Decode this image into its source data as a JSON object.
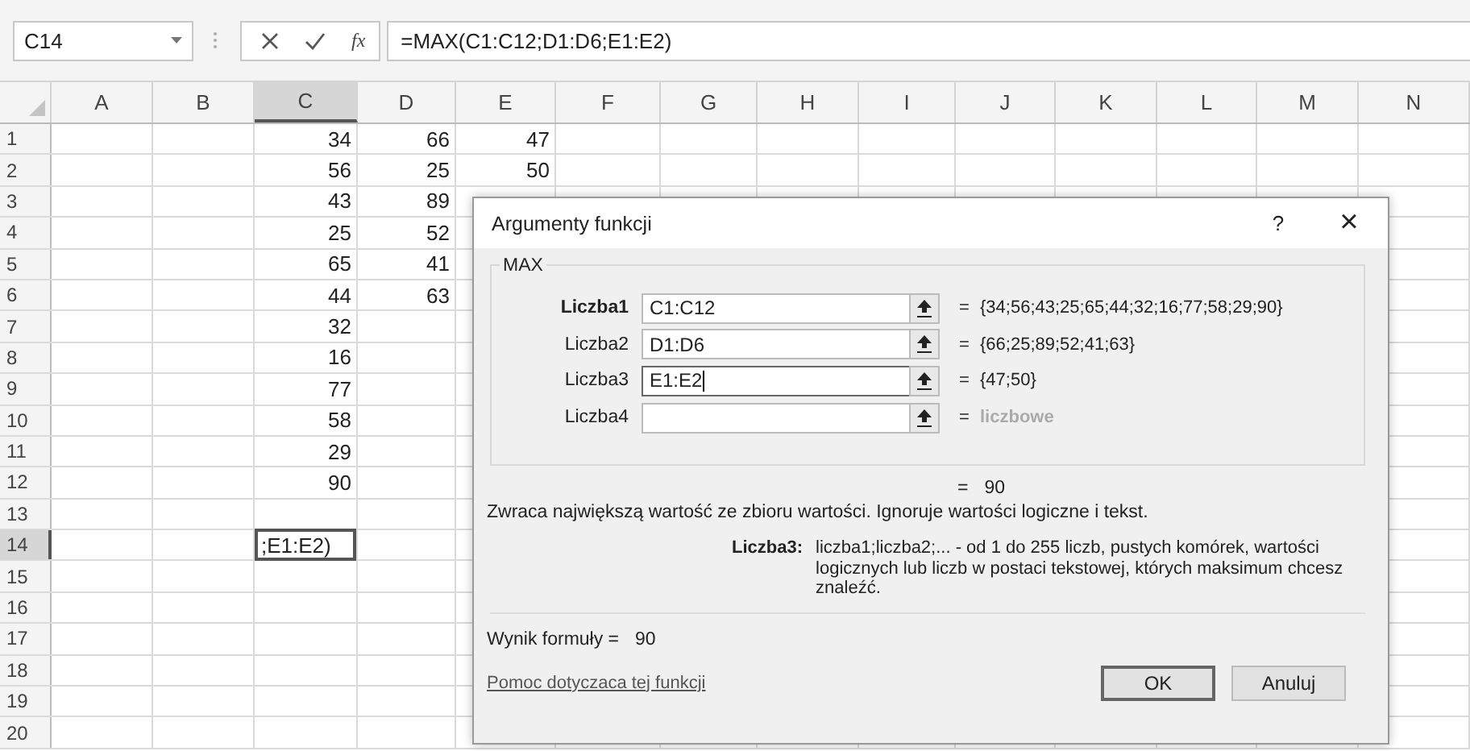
{
  "name_box": {
    "value": "C14"
  },
  "formula_bar": {
    "fx_label": "fx",
    "value": "=MAX(C1:C12;D1:D6;E1:E2)"
  },
  "columns": [
    {
      "label": "A",
      "selected": false
    },
    {
      "label": "B",
      "selected": false
    },
    {
      "label": "C",
      "selected": true
    },
    {
      "label": "D",
      "selected": false
    },
    {
      "label": "E",
      "selected": false
    },
    {
      "label": "F",
      "selected": false
    },
    {
      "label": "G",
      "selected": false
    },
    {
      "label": "H",
      "selected": false
    },
    {
      "label": "I",
      "selected": false
    },
    {
      "label": "J",
      "selected": false
    },
    {
      "label": "K",
      "selected": false
    },
    {
      "label": "L",
      "selected": false
    },
    {
      "label": "M",
      "selected": false
    },
    {
      "label": "N",
      "selected": false
    }
  ],
  "rows": [
    {
      "label": "1",
      "selected": false,
      "c": "34",
      "d": "66",
      "e": "47"
    },
    {
      "label": "2",
      "selected": false,
      "c": "56",
      "d": "25",
      "e": "50"
    },
    {
      "label": "3",
      "selected": false,
      "c": "43",
      "d": "89"
    },
    {
      "label": "4",
      "selected": false,
      "c": "25",
      "d": "52"
    },
    {
      "label": "5",
      "selected": false,
      "c": "65",
      "d": "41"
    },
    {
      "label": "6",
      "selected": false,
      "c": "44",
      "d": "63"
    },
    {
      "label": "7",
      "selected": false,
      "c": "32"
    },
    {
      "label": "8",
      "selected": false,
      "c": "16"
    },
    {
      "label": "9",
      "selected": false,
      "c": "77"
    },
    {
      "label": "10",
      "selected": false,
      "c": "58"
    },
    {
      "label": "11",
      "selected": false,
      "c": "29"
    },
    {
      "label": "12",
      "selected": false,
      "c": "90"
    },
    {
      "label": "13",
      "selected": false
    },
    {
      "label": "14",
      "selected": true,
      "c": ";E1:E2)",
      "c_editing": true
    },
    {
      "label": "15",
      "selected": false
    },
    {
      "label": "16",
      "selected": false
    },
    {
      "label": "17",
      "selected": false
    },
    {
      "label": "18",
      "selected": false
    },
    {
      "label": "19",
      "selected": false
    },
    {
      "label": "20",
      "selected": false
    }
  ],
  "dialog": {
    "title": "Argumenty funkcji",
    "help_button": "?",
    "close_button": "×",
    "function_name": "MAX",
    "arguments": [
      {
        "label": "Liczba1",
        "required": true,
        "value": "C1:C12",
        "focused": false,
        "equals": "=",
        "result": "{34;56;43;25;65;44;32;16;77;58;29;90}",
        "result_dim": false
      },
      {
        "label": "Liczba2",
        "required": false,
        "value": "D1:D6",
        "focused": false,
        "equals": "=",
        "result": "{66;25;89;52;41;63}",
        "result_dim": false
      },
      {
        "label": "Liczba3",
        "required": false,
        "value": "E1:E2",
        "focused": true,
        "equals": "=",
        "result": "{47;50}",
        "result_dim": false
      },
      {
        "label": "Liczba4",
        "required": false,
        "focused": false,
        "equals": "=",
        "result": "liczbowe",
        "result_dim": true
      }
    ],
    "result_equals": "=",
    "result": "90",
    "description": "Zwraca największą wartość ze zbioru wartości. Ignoruje wartości logiczne i tekst.",
    "argument_help_label": "Liczba3:",
    "argument_help": "liczba1;liczba2;... - od 1 do 255 liczb, pustych komórek, wartości logicznych lub liczb w postaci tekstowej, których maksimum chcesz znaleźć.",
    "formula_result_label": "Wynik formuły =",
    "formula_result": "90",
    "help_link": "Pomoc dotyczaca tej funkcji",
    "buttons": [
      {
        "label": "OK",
        "default": true
      },
      {
        "label": "Anuluj",
        "default": false
      }
    ]
  }
}
